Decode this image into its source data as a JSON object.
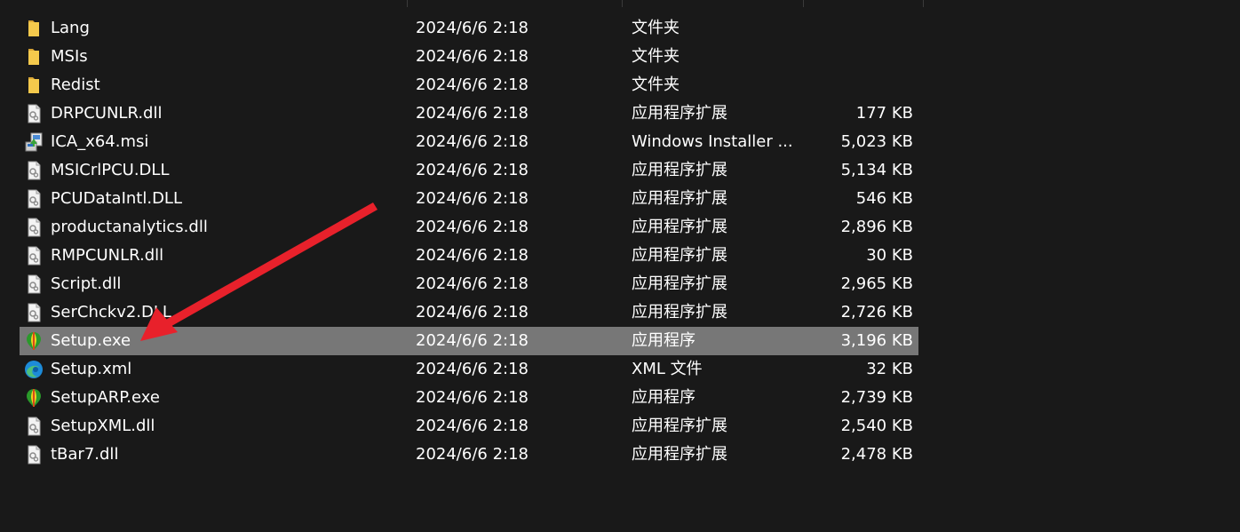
{
  "files": [
    {
      "name": "Lang",
      "date": "2024/6/6 2:18",
      "type": "文件夹",
      "size": "",
      "icon": "folder-icon"
    },
    {
      "name": "MSIs",
      "date": "2024/6/6 2:18",
      "type": "文件夹",
      "size": "",
      "icon": "folder-icon"
    },
    {
      "name": "Redist",
      "date": "2024/6/6 2:18",
      "type": "文件夹",
      "size": "",
      "icon": "folder-icon"
    },
    {
      "name": "DRPCUNLR.dll",
      "date": "2024/6/6 2:18",
      "type": "应用程序扩展",
      "size": "177 KB",
      "icon": "dll-file-icon"
    },
    {
      "name": "ICA_x64.msi",
      "date": "2024/6/6 2:18",
      "type": "Windows Installer ...",
      "size": "5,023 KB",
      "icon": "msi-installer-icon"
    },
    {
      "name": "MSICrlPCU.DLL",
      "date": "2024/6/6 2:18",
      "type": "应用程序扩展",
      "size": "5,134 KB",
      "icon": "dll-file-icon"
    },
    {
      "name": "PCUDataIntl.DLL",
      "date": "2024/6/6 2:18",
      "type": "应用程序扩展",
      "size": "546 KB",
      "icon": "dll-file-icon"
    },
    {
      "name": "productanalytics.dll",
      "date": "2024/6/6 2:18",
      "type": "应用程序扩展",
      "size": "2,896 KB",
      "icon": "dll-file-icon"
    },
    {
      "name": "RMPCUNLR.dll",
      "date": "2024/6/6 2:18",
      "type": "应用程序扩展",
      "size": "30 KB",
      "icon": "dll-file-icon"
    },
    {
      "name": "Script.dll",
      "date": "2024/6/6 2:18",
      "type": "应用程序扩展",
      "size": "2,965 KB",
      "icon": "dll-file-icon"
    },
    {
      "name": "SerChckv2.DLL",
      "date": "2024/6/6 2:18",
      "type": "应用程序扩展",
      "size": "2,726 KB",
      "icon": "dll-file-icon"
    },
    {
      "name": "Setup.exe",
      "date": "2024/6/6 2:18",
      "type": "应用程序",
      "size": "3,196 KB",
      "icon": "coreldraw-balloon-icon",
      "selected": true
    },
    {
      "name": "Setup.xml",
      "date": "2024/6/6 2:18",
      "type": "XML 文件",
      "size": "32 KB",
      "icon": "edge-browser-icon"
    },
    {
      "name": "SetupARP.exe",
      "date": "2024/6/6 2:18",
      "type": "应用程序",
      "size": "2,739 KB",
      "icon": "coreldraw-balloon-icon"
    },
    {
      "name": "SetupXML.dll",
      "date": "2024/6/6 2:18",
      "type": "应用程序扩展",
      "size": "2,540 KB",
      "icon": "dll-file-icon"
    },
    {
      "name": "tBar7.dll",
      "date": "2024/6/6 2:18",
      "type": "应用程序扩展",
      "size": "2,478 KB",
      "icon": "dll-file-icon"
    }
  ],
  "colors": {
    "background": "#191919",
    "selected_row": "#777777",
    "text": "#ffffff",
    "arrow": "#e8212b"
  }
}
